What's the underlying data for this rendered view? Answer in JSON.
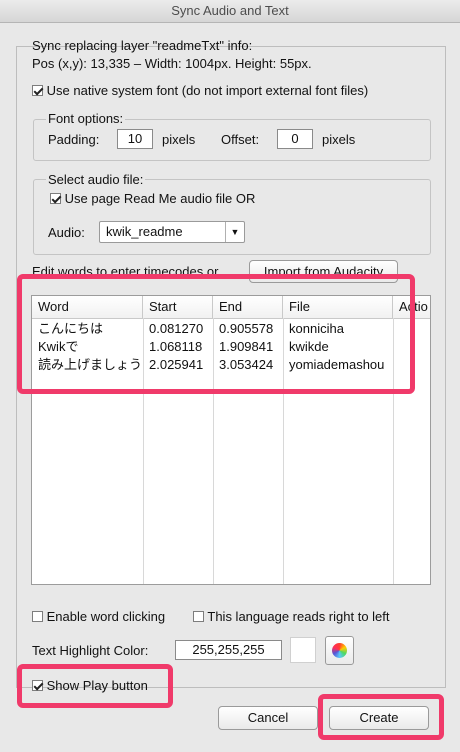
{
  "window": {
    "title": "Sync Audio and Text"
  },
  "info": {
    "heading": "Sync replacing layer \"readmeTxt\" info:",
    "pos": "Pos (x,y): 13,335 – Width: 1004px. Height: 55px."
  },
  "native_font": {
    "label": "Use native system font (do not import external font files)",
    "checked": true
  },
  "font_options": {
    "title": "Font options:",
    "padding_label": "Padding:",
    "padding_value": "10",
    "padding_unit": "pixels",
    "offset_label": "Offset:",
    "offset_value": "0",
    "offset_unit": "pixels"
  },
  "audio_file": {
    "title": "Select audio file:",
    "use_page_label": "Use page Read Me audio file  OR",
    "use_page_checked": true,
    "audio_label": "Audio:",
    "audio_value": "kwik_readme"
  },
  "edit": {
    "prompt": "Edit words to enter timecodes or",
    "import_button": "Import from Audacity"
  },
  "table": {
    "columns": [
      "Word",
      "Start",
      "End",
      "File",
      "Actio"
    ],
    "rows": [
      {
        "word": "こんにちは",
        "start": "0.081270",
        "end": "0.905578",
        "file": "konniciha"
      },
      {
        "word": "Kwikで",
        "start": "1.068118",
        "end": "1.909841",
        "file": "kwikde"
      },
      {
        "word": "読み上げましょう",
        "start": "2.025941",
        "end": "3.053424",
        "file": "yomiademashou"
      }
    ]
  },
  "options": {
    "word_clicking": "Enable word clicking",
    "rtl": "This language reads right to left",
    "highlight_label": "Text Highlight Color:",
    "highlight_value": "255,255,255",
    "show_play": "Show Play button",
    "show_play_checked": true
  },
  "buttons": {
    "cancel": "Cancel",
    "create": "Create"
  },
  "colors": {
    "annotation": "#f03a6a",
    "swatch": "#ffffff"
  }
}
